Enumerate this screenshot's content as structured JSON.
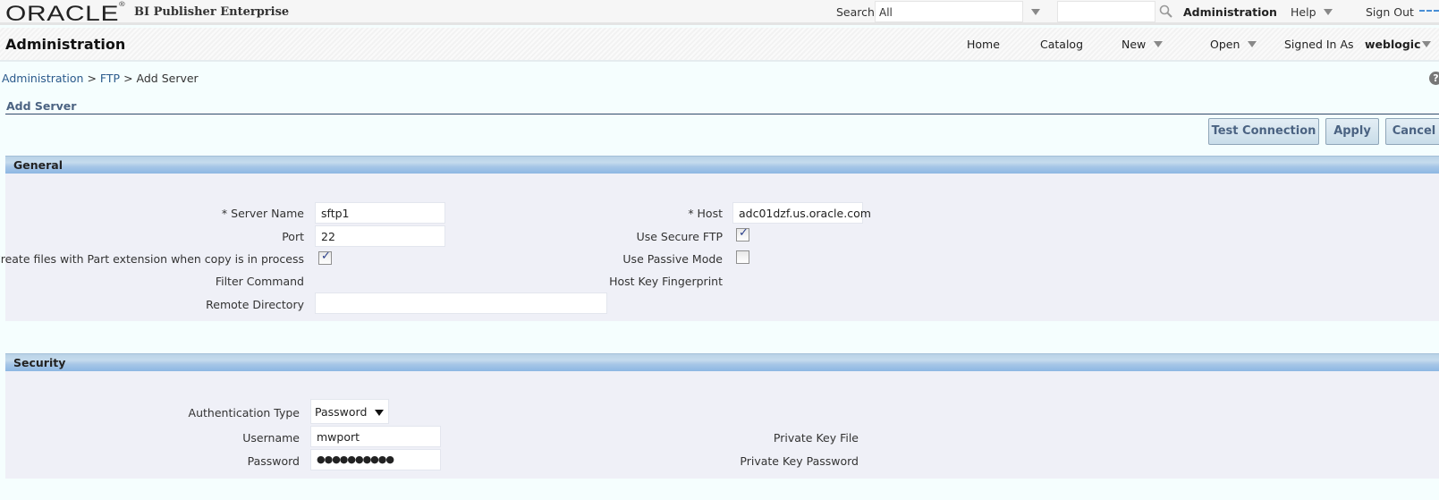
{
  "header": {
    "logo": "ORACLE",
    "product": "BI Publisher Enterprise",
    "search_label": "Search",
    "search_scope": "All",
    "search_query": "",
    "admin_link": "Administration",
    "help_link": "Help",
    "signout_link": "Sign Out"
  },
  "appbar": {
    "title": "Administration",
    "nav": {
      "home": "Home",
      "catalog": "Catalog",
      "new": "New",
      "open": "Open",
      "signed_in_as": "Signed In As",
      "user": "weblogic"
    }
  },
  "breadcrumb": {
    "items": [
      "Administration",
      "FTP",
      "Add Server"
    ],
    "separator": ">"
  },
  "help_icon": "?",
  "page": {
    "subtitle": "Add Server",
    "buttons": {
      "test_connection": "Test Connection",
      "apply": "Apply",
      "cancel": "Cancel"
    }
  },
  "general": {
    "title": "General",
    "server_name_label": "* Server Name",
    "server_name": "sftp1",
    "port_label": "Port",
    "port": "22",
    "part_extension_label": "Create files with Part extension when copy is in process",
    "part_extension_checked": true,
    "filter_command_label": "Filter Command",
    "remote_directory_label": "Remote Directory",
    "remote_directory": "",
    "host_label": "* Host",
    "host": "adc01dzf.us.oracle.com",
    "use_secure_ftp_label": "Use Secure FTP",
    "use_secure_ftp_checked": true,
    "use_passive_mode_label": "Use Passive Mode",
    "use_passive_mode_checked": false,
    "host_key_fingerprint_label": "Host Key Fingerprint"
  },
  "security": {
    "title": "Security",
    "auth_type_label": "Authentication Type",
    "auth_type": "Password",
    "username_label": "Username",
    "username": "mwport",
    "password_label": "Password",
    "password": "●●●●●●●●●●",
    "private_key_file_label": "Private Key File",
    "private_key_password_label": "Private Key Password"
  },
  "colors": {
    "accent": "#4b6382",
    "link": "#2a5a8c",
    "section_header": "#a6c6e7",
    "section_body": "#eff0f7"
  }
}
